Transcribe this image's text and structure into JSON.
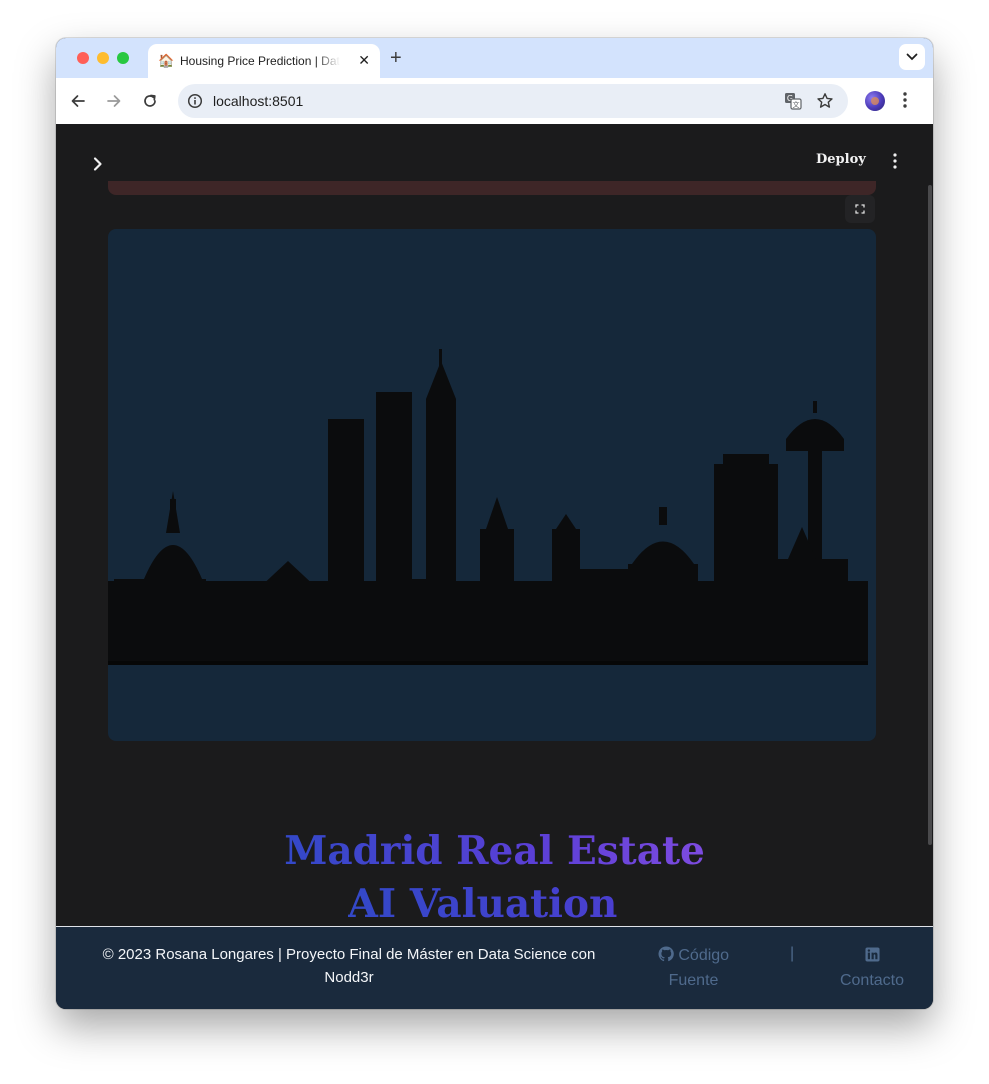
{
  "browser": {
    "tab": {
      "favicon": "house-icon",
      "title": "Housing Price Prediction | Data Science"
    },
    "url": "localhost:8501"
  },
  "app": {
    "header": {
      "deploy_label": "Deploy"
    },
    "title_line1": "Madrid Real Estate",
    "title_line2": "AI Valuation",
    "footer": {
      "copyright_line1": "© 2023 Rosana Longares | Proyecto Final de Máster en Data Science con",
      "copyright_line2": "Nodd3r",
      "source_line1": "Código",
      "source_line2": "Fuente",
      "separator": "|",
      "contact": "Contacto"
    }
  },
  "colors": {
    "app_bg": "#1b1b1c",
    "hero_bg": "#15283a",
    "title_gradient": [
      "#3348c8",
      "#7d4be0"
    ],
    "footer_bg": "#1a2a3d",
    "footer_link": "#4f6a8c"
  }
}
